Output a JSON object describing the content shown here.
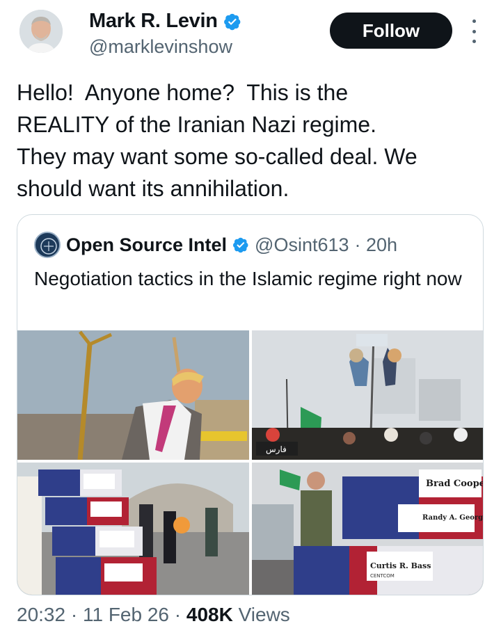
{
  "author": {
    "name": "Mark R. Levin",
    "handle": "@marklevinshow",
    "verified_icon": "verified-badge-icon",
    "verified_color": "#1d9bf0"
  },
  "actions": {
    "follow_label": "Follow",
    "more_icon": "more-vertical-icon"
  },
  "tweet": {
    "text": "Hello!  Anyone home?  This is the\nREALITY of the Iranian Nazi regime.\nThey may want some so-called deal. We\nshould want its annihilation."
  },
  "quoted": {
    "name": "Open Source Intel",
    "handle": "@Osint613",
    "time": "· 20h",
    "text": "Negotiation tactics in the Islamic regime right now",
    "image_labels": {
      "watermark": "فارس",
      "coffin_1": "Brad Cooper",
      "coffin_2": "Randy A. George",
      "coffin_3": "Curtis R. Bass",
      "coffin_3_sub": "CENTCOM"
    }
  },
  "footer": {
    "time": "20:32",
    "sep1": " · ",
    "date": "11 Feb 26",
    "sep2": " · ",
    "views_count": "408K",
    "views_label": " Views"
  },
  "colors": {
    "text": "#0f1419",
    "secondary": "#536471",
    "border": "#cfd9de",
    "button": "#0f1419"
  }
}
